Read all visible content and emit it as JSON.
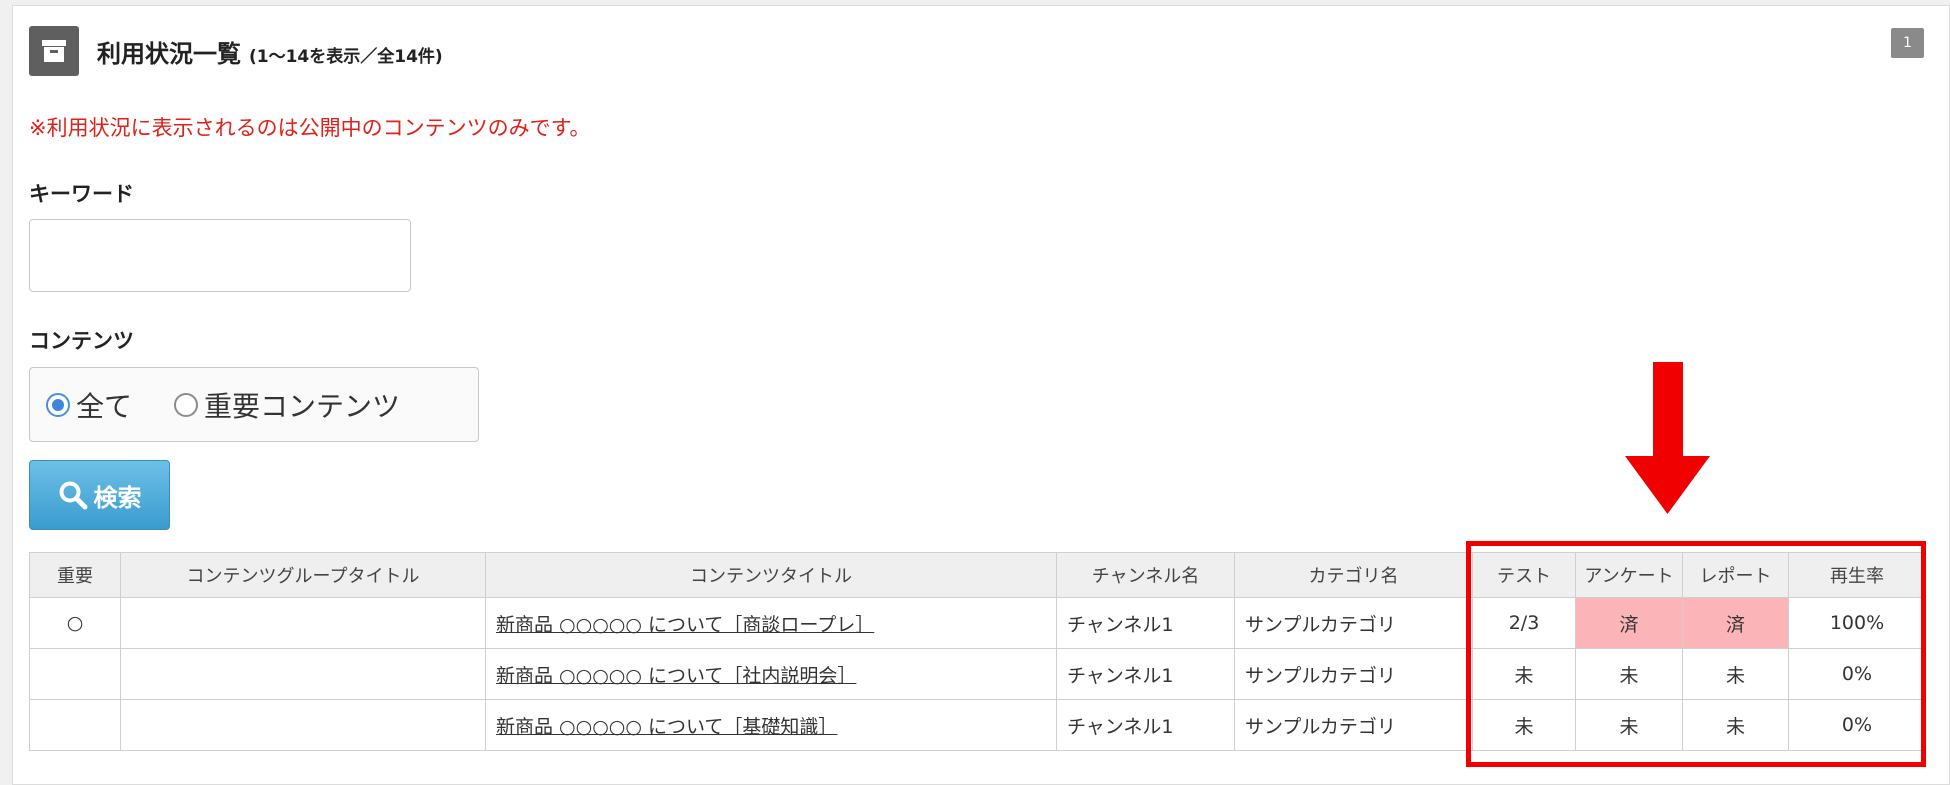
{
  "header": {
    "title": "利用状況一覧",
    "count_text": "(1～14を表示／全14件)",
    "page_number": "1",
    "icon": "archive-box-icon"
  },
  "notice": "※利用状況に表示されるのは公開中のコンテンツのみです。",
  "filters": {
    "keyword_label": "キーワード",
    "keyword_value": "",
    "content_label": "コンテンツ",
    "content_options": [
      {
        "label": "全て",
        "checked": true
      },
      {
        "label": "重要コンテンツ",
        "checked": false
      }
    ],
    "search_label": "検索",
    "search_icon": "magnifier-icon"
  },
  "table": {
    "columns": [
      "重要",
      "コンテンツグループタイトル",
      "コンテンツタイトル",
      "チャンネル名",
      "カテゴリ名",
      "テスト",
      "アンケート",
      "レポート",
      "再生率"
    ],
    "rows": [
      {
        "important": "○",
        "group": "",
        "title": "新商品 ○○○○○ について［商談ロープレ］",
        "channel": "チャンネル1",
        "category": "サンプルカテゴリ",
        "test": "2/3",
        "survey": "済",
        "report": "済",
        "play_rate": "100%"
      },
      {
        "important": "",
        "group": "",
        "title": "新商品 ○○○○○ について［社内説明会］",
        "channel": "チャンネル1",
        "category": "サンプルカテゴリ",
        "test": "未",
        "survey": "未",
        "report": "未",
        "play_rate": "0%"
      },
      {
        "important": "",
        "group": "",
        "title": "新商品 ○○○○○ について［基礎知識］",
        "channel": "チャンネル1",
        "category": "サンプルカテゴリ",
        "test": "未",
        "survey": "未",
        "report": "未",
        "play_rate": "0%"
      }
    ]
  },
  "colors": {
    "notice_red": "#e0201a",
    "annotation_red": "#f00000",
    "done_cell": "#fbb4b8",
    "search_button": "#3a9ccf"
  }
}
